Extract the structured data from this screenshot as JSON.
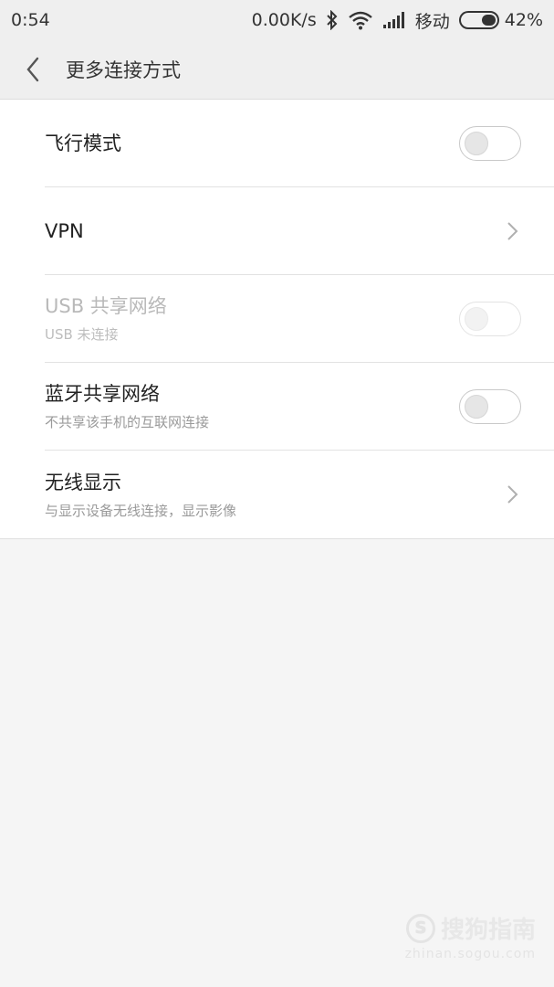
{
  "status_bar": {
    "time": "0:54",
    "net_speed": "0.00K/s",
    "carrier": "移动",
    "battery": "42%",
    "battery_level": 0.42,
    "icons": [
      "bluetooth-icon",
      "wifi-icon",
      "signal-icon",
      "battery-icon"
    ]
  },
  "header": {
    "title": "更多连接方式",
    "back_icon": "chevron-left-icon"
  },
  "items": [
    {
      "title": "飞行模式",
      "subtitle": "",
      "control": "toggle",
      "on": false,
      "enabled": true
    },
    {
      "title": "VPN",
      "subtitle": "",
      "control": "chevron",
      "enabled": true
    },
    {
      "title": "USB 共享网络",
      "subtitle": "USB 未连接",
      "control": "toggle",
      "on": false,
      "enabled": false
    },
    {
      "title": "蓝牙共享网络",
      "subtitle": "不共享该手机的互联网连接",
      "control": "toggle",
      "on": false,
      "enabled": true
    },
    {
      "title": "无线显示",
      "subtitle": "与显示设备无线连接，显示影像",
      "control": "chevron",
      "enabled": true
    }
  ],
  "watermark": {
    "logo_letter": "S",
    "text": "搜狗指南",
    "url": "zhinan.sogou.com"
  },
  "colors": {
    "header_bg": "#efefef",
    "page_bg": "#f5f5f5",
    "list_bg": "#ffffff"
  }
}
